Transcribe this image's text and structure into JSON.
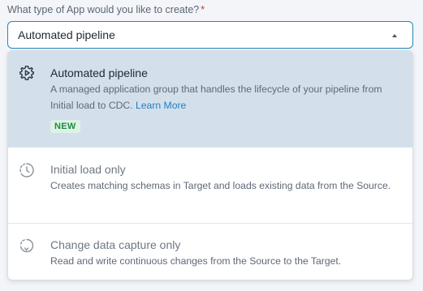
{
  "field": {
    "label": "What type of App would you like to create?",
    "required_marker": "*",
    "selected_value": "Automated pipeline"
  },
  "options": [
    {
      "icon": "gear-play-icon",
      "title": "Automated pipeline",
      "description": "A managed application group that handles the lifecycle of your pipeline from Initial load to CDC.",
      "link": "Learn More",
      "badge": "NEW",
      "selected": true
    },
    {
      "icon": "history-clock-icon",
      "title": "Initial load only",
      "description": "Creates matching schemas in Target and loads existing data from the Source.",
      "selected": false
    },
    {
      "icon": "loading-refresh-icon",
      "title": "Change data capture only",
      "description": "Read and write continuous changes from the Source to the Target.",
      "selected": false
    }
  ],
  "colors": {
    "accent_border": "#1e8ab8",
    "selected_bg": "#d3e0ec",
    "link": "#1e7fc0",
    "badge_bg": "#dcf3e3",
    "badge_text": "#1f8a47",
    "required": "#d1343a"
  }
}
